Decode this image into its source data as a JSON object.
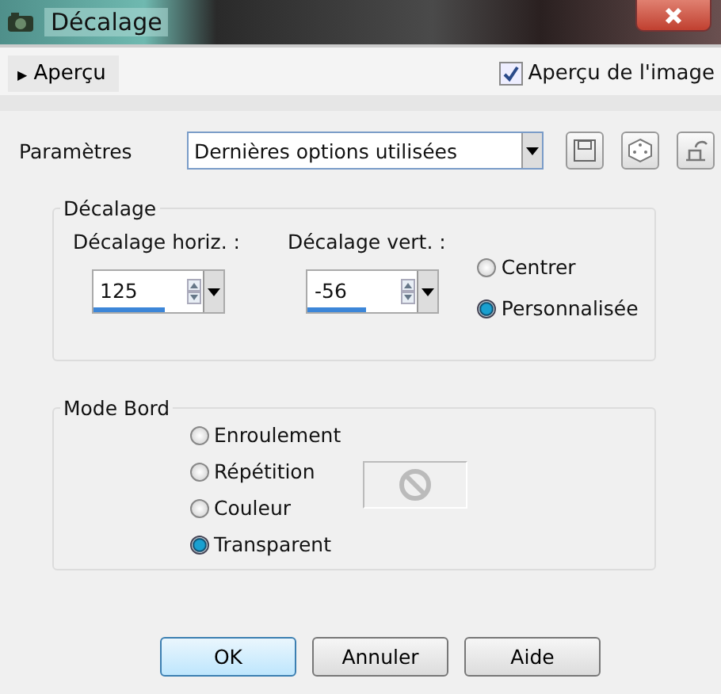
{
  "window": {
    "title": "Décalage"
  },
  "preview": {
    "toggle_icon": "▶",
    "label": "Aperçu",
    "expanded": false
  },
  "image_preview": {
    "label": "Aperçu de l'image",
    "checked": true
  },
  "presets": {
    "label": "Paramètres",
    "value": "Dernières options utilisées"
  },
  "offset_group": {
    "title": "Décalage",
    "spinners": [
      {
        "label": "Décalage horiz. :",
        "value": "125",
        "level": 0.55
      },
      {
        "label": "Décalage vert.  :",
        "value": "-56",
        "level": 0.45
      }
    ],
    "options": [
      {
        "label": "Centrer",
        "selected": false
      },
      {
        "label": "Personnalisée",
        "selected": true
      }
    ]
  },
  "edge_group": {
    "title": "Mode Bord",
    "options": [
      {
        "label": "Enroulement",
        "selected": false
      },
      {
        "label": "Répétition",
        "selected": false
      },
      {
        "label": "Couleur",
        "selected": false
      },
      {
        "label": "Transparent",
        "selected": true
      }
    ]
  },
  "buttons": [
    {
      "label": "OK",
      "kind": "default"
    },
    {
      "label": "Annuler",
      "kind": "normal"
    },
    {
      "label": "Aide",
      "kind": "normal"
    }
  ]
}
